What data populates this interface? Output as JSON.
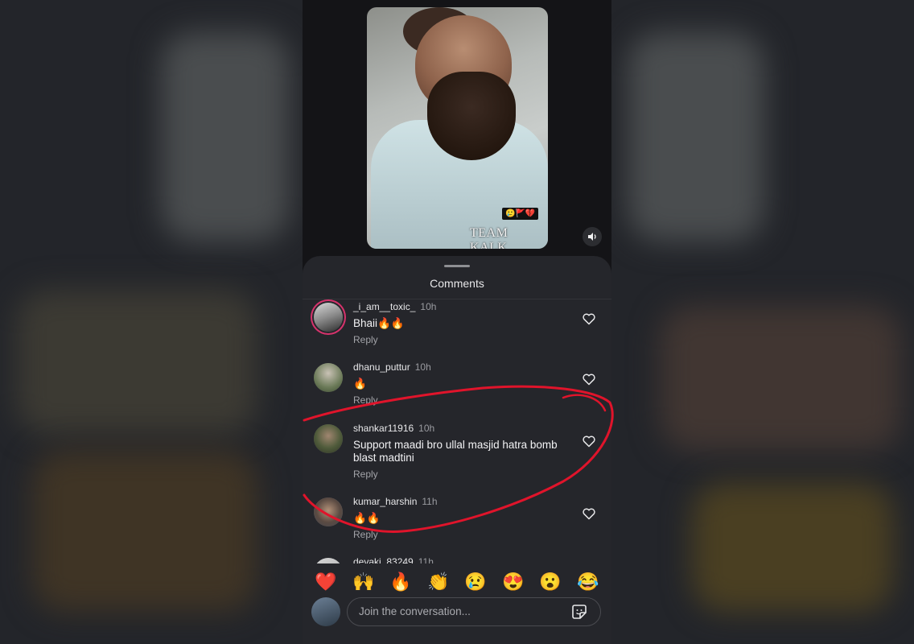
{
  "video": {
    "emoji_tag": "🥲🚩💔",
    "watermark": "TEAM KALK"
  },
  "sheet": {
    "title": "Comments"
  },
  "comments": [
    {
      "username": "_i_am__toxic_",
      "time": "10h",
      "text": "Bhaii🔥🔥",
      "reply": "Reply"
    },
    {
      "username": "dhanu_puttur",
      "time": "10h",
      "text": "🔥",
      "reply": "Reply"
    },
    {
      "username": "shankar11916",
      "time": "10h",
      "text": "Support maadi bro ullal masjid hatra bomb blast madtini",
      "reply": "Reply"
    },
    {
      "username": "kumar_harshin",
      "time": "11h",
      "text": "🔥🔥",
      "reply": "Reply"
    },
    {
      "username": "devaki_83249",
      "time": "11h"
    }
  ],
  "reactions": [
    "❤️",
    "🙌",
    "🔥",
    "👏",
    "😢",
    "😍",
    "😮",
    "😂"
  ],
  "compose": {
    "placeholder": "Join the conversation..."
  },
  "colors": {
    "annotation": "#e0142b",
    "sheet_bg": "#25262b",
    "story_ring": "#d6336c"
  }
}
